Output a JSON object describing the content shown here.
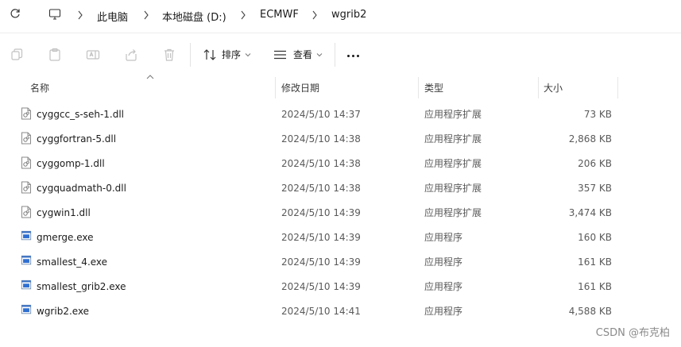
{
  "breadcrumb": {
    "items": [
      "此电脑",
      "本地磁盘 (D:)",
      "ECMWF",
      "wgrib2"
    ]
  },
  "toolbar": {
    "sort_label": "排序",
    "view_label": "查看",
    "more_label": "···"
  },
  "columns": {
    "name": "名称",
    "date": "修改日期",
    "type": "类型",
    "size": "大小"
  },
  "files": [
    {
      "name": "cyggcc_s-seh-1.dll",
      "date": "2024/5/10 14:37",
      "type": "应用程序扩展",
      "size": "73 KB",
      "icon": "dll-file-icon"
    },
    {
      "name": "cyggfortran-5.dll",
      "date": "2024/5/10 14:38",
      "type": "应用程序扩展",
      "size": "2,868 KB",
      "icon": "dll-file-icon"
    },
    {
      "name": "cyggomp-1.dll",
      "date": "2024/5/10 14:38",
      "type": "应用程序扩展",
      "size": "206 KB",
      "icon": "dll-file-icon"
    },
    {
      "name": "cygquadmath-0.dll",
      "date": "2024/5/10 14:38",
      "type": "应用程序扩展",
      "size": "357 KB",
      "icon": "dll-file-icon"
    },
    {
      "name": "cygwin1.dll",
      "date": "2024/5/10 14:39",
      "type": "应用程序扩展",
      "size": "3,474 KB",
      "icon": "dll-file-icon"
    },
    {
      "name": "gmerge.exe",
      "date": "2024/5/10 14:39",
      "type": "应用程序",
      "size": "160 KB",
      "icon": "exe-file-icon"
    },
    {
      "name": "smallest_4.exe",
      "date": "2024/5/10 14:39",
      "type": "应用程序",
      "size": "161 KB",
      "icon": "exe-file-icon"
    },
    {
      "name": "smallest_grib2.exe",
      "date": "2024/5/10 14:39",
      "type": "应用程序",
      "size": "161 KB",
      "icon": "exe-file-icon"
    },
    {
      "name": "wgrib2.exe",
      "date": "2024/5/10 14:41",
      "type": "应用程序",
      "size": "4,588 KB",
      "icon": "exe-file-icon"
    }
  ],
  "watermark": "CSDN @布克柏"
}
